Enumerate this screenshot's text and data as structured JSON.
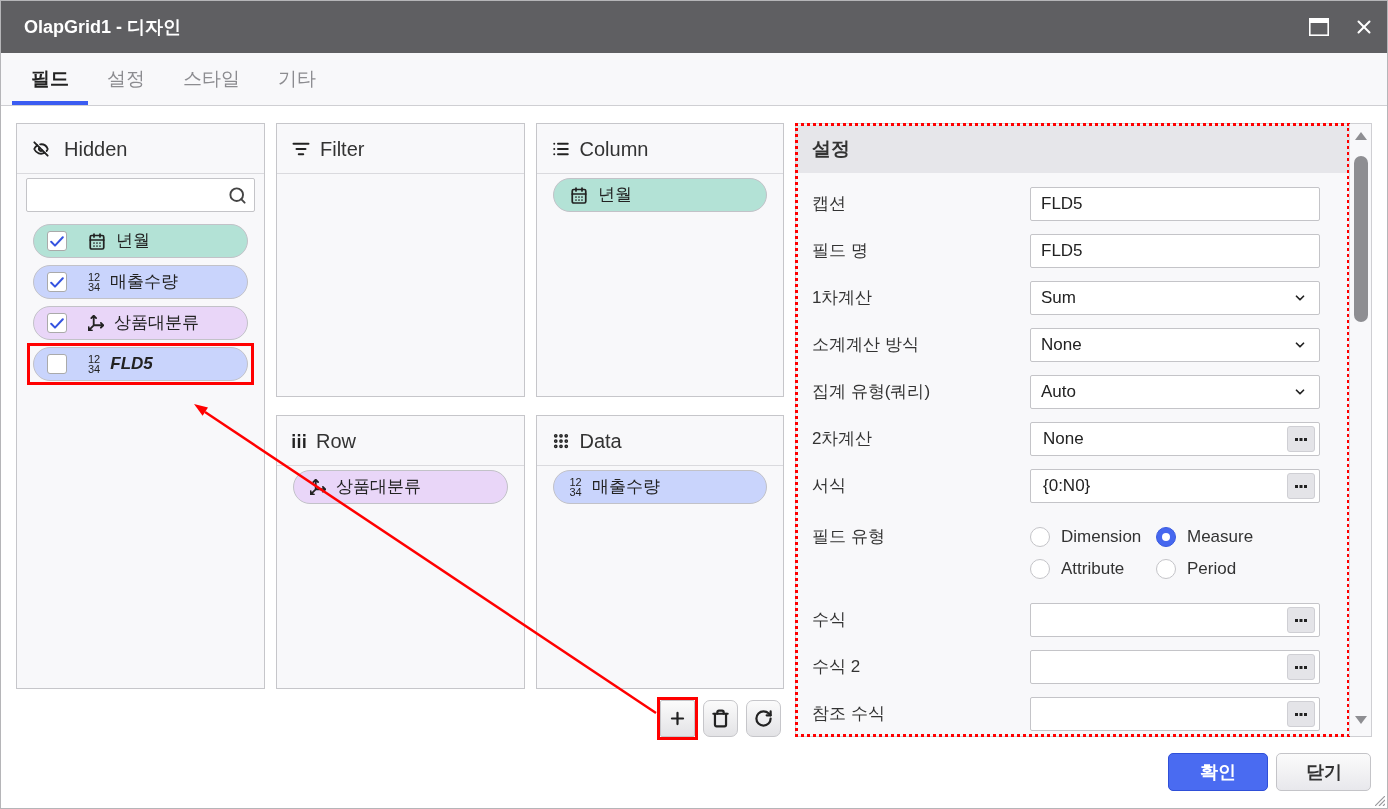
{
  "window": {
    "title": "OlapGrid1 - 디자인"
  },
  "tabs": [
    {
      "label": "필드",
      "selected": true
    },
    {
      "label": "설정",
      "selected": false
    },
    {
      "label": "스타일",
      "selected": false
    },
    {
      "label": "기타",
      "selected": false
    }
  ],
  "hidden_panel": {
    "title": "Hidden",
    "items": [
      {
        "kind": "date",
        "label": "년월",
        "checked": true,
        "color": "#b3e2d6",
        "highlighted": false,
        "emphasized": false
      },
      {
        "kind": "measure",
        "type_glyph": [
          "12",
          "34"
        ],
        "label": "매출수량",
        "checked": true,
        "color": "#c9d4fc",
        "highlighted": false,
        "emphasized": false
      },
      {
        "kind": "dimension",
        "label": "상품대분류",
        "checked": true,
        "color": "#e9d6f8",
        "highlighted": false,
        "emphasized": false
      },
      {
        "kind": "measure",
        "type_glyph": [
          "12",
          "34"
        ],
        "label": "FLD5",
        "checked": false,
        "color": "#c9d4fc",
        "highlighted": true,
        "emphasized": true
      }
    ]
  },
  "zones": [
    {
      "kind": "filter",
      "title": "Filter"
    },
    {
      "kind": "column",
      "title": "Column",
      "items": [
        {
          "kind": "date",
          "label": "년월",
          "color": "#b3e2d6"
        }
      ]
    },
    {
      "kind": "row",
      "title": "Row",
      "items": [
        {
          "kind": "dimension",
          "label": "상품대분류",
          "color": "#e9d6f8"
        }
      ]
    },
    {
      "kind": "data",
      "title": "Data",
      "items": [
        {
          "kind": "measure",
          "type_glyph": [
            "12",
            "34"
          ],
          "label": "매출수량",
          "color": "#c9d4fc"
        }
      ]
    }
  ],
  "toolbar": [
    {
      "kind": "add",
      "highlighted": true
    },
    {
      "kind": "delete",
      "highlighted": false
    },
    {
      "kind": "refresh",
      "highlighted": false
    }
  ],
  "callout_arrow": true,
  "settings": {
    "title": "설정",
    "highlighted": true,
    "rows": [
      {
        "kind": "text",
        "label": "캡션",
        "value": "FLD5"
      },
      {
        "kind": "text",
        "label": "필드 명",
        "value": "FLD5"
      },
      {
        "kind": "select",
        "label": "1차계산",
        "value": "Sum"
      },
      {
        "kind": "select",
        "label": "소계계산 방식",
        "value": "None"
      },
      {
        "kind": "select",
        "label": "집계 유형(쿼리)",
        "value": "Auto"
      },
      {
        "kind": "picker",
        "label": "2차계산",
        "value": "None"
      },
      {
        "kind": "picker",
        "label": "서식",
        "value": "{0:N0}"
      },
      {
        "kind": "radio",
        "label": "필드 유형",
        "options": [
          {
            "label": "Dimension",
            "selected": false
          },
          {
            "label": "Measure",
            "selected": true
          },
          {
            "label": "Attribute",
            "selected": false
          },
          {
            "label": "Period",
            "selected": false
          }
        ]
      },
      {
        "kind": "picker",
        "label": "수식"
      },
      {
        "kind": "picker",
        "label": "수식 2"
      },
      {
        "kind": "picker",
        "label": "참조 수식"
      }
    ]
  },
  "buttons": [
    {
      "kind": "primary",
      "label": "확인"
    },
    {
      "kind": "secondary",
      "label": "닫기"
    }
  ]
}
